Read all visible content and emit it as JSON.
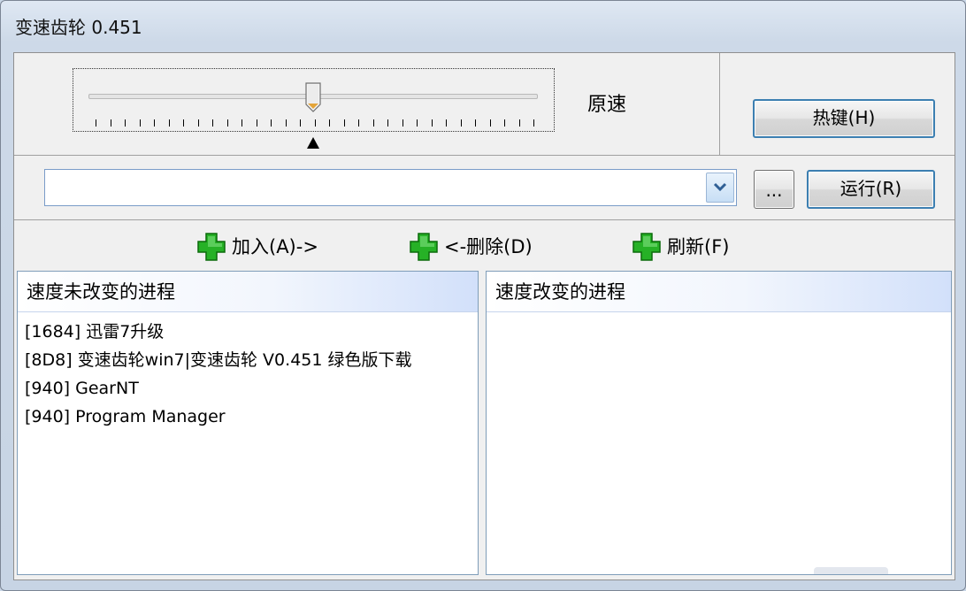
{
  "window": {
    "title": "变速齿轮 0.451"
  },
  "speed": {
    "label": "原速"
  },
  "buttons": {
    "hotkey": "热键(H)",
    "browse": "...",
    "run": "运行(R)"
  },
  "program_input": {
    "value": "",
    "placeholder": ""
  },
  "actions": {
    "add": "加入(A)->",
    "remove": "<-删除(D)",
    "refresh": "刷新(F)"
  },
  "panels": {
    "left": {
      "header": "速度未改变的进程",
      "items": [
        {
          "label": "[1684]  迅雷7升级"
        },
        {
          "label": "[8D8]  变速齿轮win7|变速齿轮 V0.451 绿色版下载"
        },
        {
          "label": "[940]  GearNT"
        },
        {
          "label": "[940]  Program Manager"
        }
      ]
    },
    "right": {
      "header": "速度改变的进程",
      "items": []
    }
  },
  "colors": {
    "accent": "#3c7fb1",
    "plus_icon": "#1fa61f",
    "header_gradient_end": "#d2e0fa"
  },
  "icons": {
    "action_icon": "green-plus-icon",
    "dropdown": "chevron-down-icon"
  }
}
